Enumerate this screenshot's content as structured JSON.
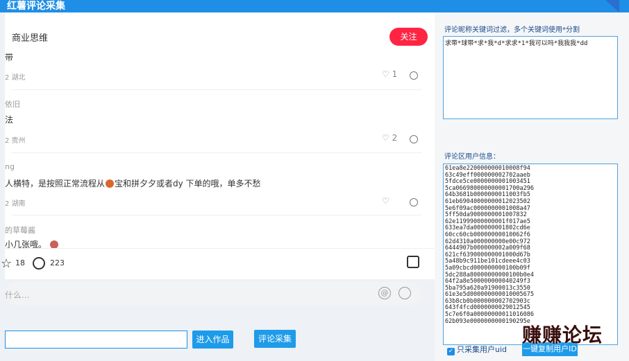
{
  "app": {
    "title": "红薯评论采集"
  },
  "post": {
    "author": "商业思维",
    "follow_label": "关注"
  },
  "comments": [
    {
      "user": "",
      "text": "带",
      "meta": "2 湖北",
      "likes": "1"
    },
    {
      "user": "依旧",
      "text": "法",
      "meta": "2 贵州",
      "likes": "2"
    },
    {
      "user": "ng",
      "text_before": "人横特，是按照正常流程从",
      "text_after": "宝和拼夕夕或者dy 下单的哦，单多不愁",
      "meta": "2 湖南",
      "likes": ""
    },
    {
      "user": "的草莓酱",
      "text": "小几张哦。",
      "meta": "",
      "likes": ""
    }
  ],
  "stats": {
    "stars": "18",
    "comments": "223"
  },
  "input": {
    "placeholder": "什么..."
  },
  "actions": {
    "enter_label": "进入作品",
    "collect_label": "评论采集"
  },
  "filter": {
    "label": "评论昵称关键词过滤，多个关键词使用*分割",
    "value": "求带*球带*求*我*d*求求*1*我可以吗*我我我*dd"
  },
  "user_info": {
    "label": "评论区用户信息：",
    "ids": [
      "61ea8e22000000001 0008f94",
      "63c49eff000000002702aaeb",
      "5fdce5ce0000000001003451",
      "5ca066980000000001700a296",
      "64b3681b000000001 1003fb5",
      "61eb69040000000012023502",
      "5e6f09ac000000000 1008a47",
      "5ff50da9000000001007832",
      "62e11999000000001f017ae5",
      "633ea7da000000001802cd6e",
      "60cc60cb0000000001006 2f6",
      "62d4310a000000000e00c972",
      "6444907b000000002a009f68",
      "621cf639000000001 000d67b",
      "5a48b9c911be101cdeee4c03",
      "5a09cbcd000000000100b09f",
      "5dc288a800000000001 00b0e4",
      "64f2a8e500000000040249f3",
      "5ba795a620a91900013c3550",
      "61e3e5d000000000010005675",
      "63b8cb0b000000002702903c",
      "643f4fcd000000002901 2545",
      "5c7e6f0a0000000001 1016086",
      "62b093e000000000019029 5e"
    ]
  },
  "options": {
    "uid_only_label": "只采集用户uid",
    "uid_only_checked": true,
    "copy_label": "一键复制用户ID"
  },
  "watermark": "赚赚论坛",
  "colors": {
    "accent": "#1e8ee6",
    "follow": "#ff2442"
  }
}
